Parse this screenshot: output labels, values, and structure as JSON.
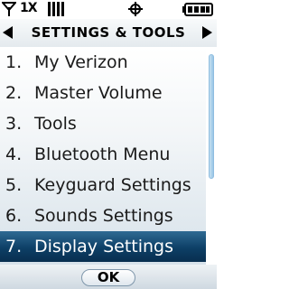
{
  "status": {
    "signal_icon": "antenna-icon",
    "network": "1X",
    "signal_bars_icon": "signal-strength-icon",
    "gps_icon": "gps-location-icon",
    "battery_icon": "battery-full-icon"
  },
  "header": {
    "title": "SETTINGS & TOOLS",
    "left_icon": "arrow-left-icon",
    "right_icon": "arrow-right-icon"
  },
  "menu": {
    "items": [
      {
        "number": "1.",
        "label": "My Verizon"
      },
      {
        "number": "2.",
        "label": "Master Volume"
      },
      {
        "number": "3.",
        "label": "Tools"
      },
      {
        "number": "4.",
        "label": "Bluetooth Menu"
      },
      {
        "number": "5.",
        "label": "Keyguard Settings"
      },
      {
        "number": "6.",
        "label": "Sounds Settings"
      },
      {
        "number": "7.",
        "label": "Display Settings"
      }
    ],
    "selected_index": 6
  },
  "softkeys": {
    "center": "OK"
  },
  "colors": {
    "selection": "#0d3f66",
    "selection_text": "#ffffff",
    "text": "#1a1a1a"
  }
}
